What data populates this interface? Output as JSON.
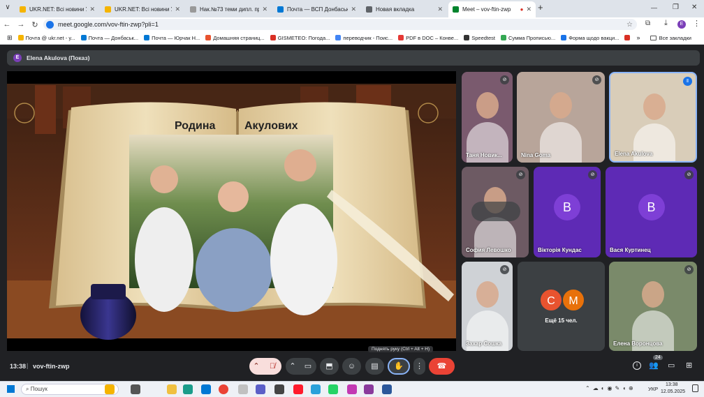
{
  "tabs": [
    {
      "title": "UKR.NET: Всі новини України, ",
      "color": "#f5b400"
    },
    {
      "title": "UKR.NET: Всі новини України, ",
      "color": "#f5b400"
    },
    {
      "title": "Нак.№73 теми дипл. проектів",
      "color": "#999999"
    },
    {
      "title": "Почта — ВСП Донбаський агр",
      "color": "#0078d4"
    },
    {
      "title": "Новая вкладка",
      "color": "#5f6368"
    },
    {
      "title": "Meet – vov-ftin-zwp",
      "color": "#00832d"
    }
  ],
  "window": {
    "tab_dropdown": "∨",
    "new_tab": "+",
    "minimize": "—",
    "maximize": "❐",
    "close": "✕",
    "tab_close": "✕",
    "recording": "●"
  },
  "url": "meet.google.com/vov-ftin-zwp?pli=1",
  "profile_initial": "E",
  "bookmarks": [
    "Почта @ ukr.net - у...",
    "Почта — Донбаськ...",
    "Почта — Юрчак Н...",
    "Домашняя страниц...",
    "GISMETEO: Погода...",
    "переводчик - Поис...",
    "PDF в DOC – Конве...",
    "Speedtest",
    "Сумма Прописью...",
    "Форма щодо вакци...",
    "Яндекс",
    "Gmail"
  ],
  "bookmarks_more": "»",
  "all_bookmarks": "Все закладки",
  "presenter": {
    "initial": "E",
    "label": "Elena Akulova (Показ)"
  },
  "book": {
    "word1": "Родина",
    "word2": "Акулових"
  },
  "participants": [
    {
      "name": "Таня Новик...",
      "muted": true
    },
    {
      "name": "Nina Goma",
      "muted": false
    },
    {
      "name": "Elena Akulova",
      "muted": false,
      "speaking": true
    },
    {
      "name": "София Левошко",
      "muted": true
    },
    {
      "name": "Вікторія Кундас",
      "muted": true,
      "initial": "В"
    },
    {
      "name": "Вася Куртинец",
      "muted": true,
      "initial": "В"
    },
    {
      "name": "Захар Сошка",
      "muted": true
    },
    {
      "name": "Елена Воронцова",
      "muted": true
    }
  ],
  "more_tile": {
    "avatars": [
      "С",
      "М"
    ],
    "label": "Ещё 15 чел."
  },
  "meeting": {
    "time": "13:38",
    "code": "vov-ftin-zwp",
    "divider": "|"
  },
  "tooltip": "Поднять руку (Ctrl + Alt + H)",
  "people_count": "24",
  "taskbar": {
    "search": "Пошук",
    "lang": "УКР",
    "time": "13:38",
    "date": "12.05.2025"
  },
  "colors": {
    "meet_bg": "#202124",
    "end_call": "#ea4335",
    "muted": "#f9dedc",
    "avatar_purple": "#5e2ab5",
    "avatar_c": "#e8532f",
    "avatar_m": "#e8710a",
    "speaking": "#8ab4f8"
  }
}
